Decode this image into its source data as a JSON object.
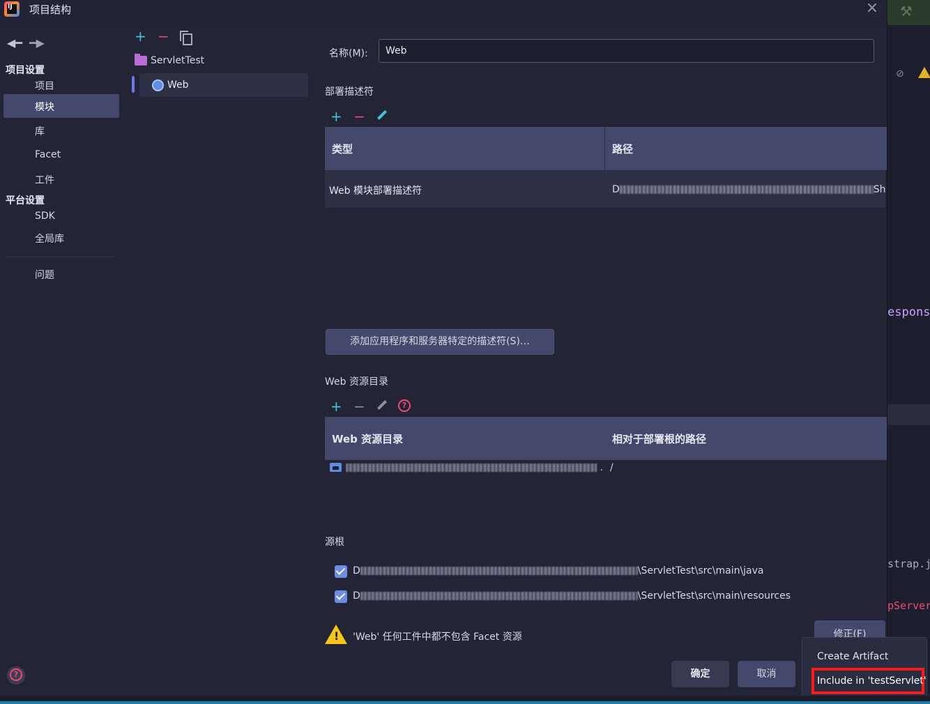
{
  "window": {
    "title": "项目结构",
    "close": "×"
  },
  "nav": {
    "back_icon": "arrow-left-icon",
    "forward_icon": "arrow-right-icon",
    "sections": [
      {
        "title": "项目设置",
        "items": [
          "项目",
          "模块",
          "库",
          "Facet",
          "工件"
        ]
      },
      {
        "title": "平台设置",
        "items": [
          "SDK",
          "全局库"
        ]
      }
    ],
    "problems": "问题",
    "selected": "模块"
  },
  "tree": {
    "add": "+",
    "remove": "−",
    "root": "ServletTest",
    "child": "Web"
  },
  "name": {
    "label": "名称(M):",
    "value": "Web"
  },
  "descriptors": {
    "title": "部署描述符",
    "columns": [
      "类型",
      "路径"
    ],
    "rows": [
      {
        "type": "Web 模块部署描述符",
        "path_prefix": "D",
        "path_suffix": "Sh"
      }
    ],
    "add_button": "添加应用程序和服务器特定的描述符(S)…"
  },
  "web_resources": {
    "title": "Web 资源目录",
    "columns": [
      "Web 资源目录",
      "相对于部署根的路径"
    ],
    "rows": [
      {
        "path_prefix": "",
        "path_suffix": "..",
        "relative": "/"
      }
    ]
  },
  "source_roots": {
    "title": "源根",
    "items": [
      {
        "prefix": "D",
        "suffix": "\\ServletTest\\src\\main\\java",
        "checked": true
      },
      {
        "prefix": "D",
        "suffix": "\\ServletTest\\src\\main\\resources",
        "checked": true
      }
    ]
  },
  "warning": {
    "text": "'Web' 任何工件中都不包含 Facet 资源",
    "mark": "!"
  },
  "buttons": {
    "fix": "修正(F)",
    "ok": "确定",
    "cancel": "取消"
  },
  "popup": {
    "items": [
      "Create Artifact",
      "Include in 'testServlet'"
    ]
  },
  "background_editor": {
    "code_1": "espons",
    "code_2": "strap.j",
    "code_3": "pServer"
  },
  "colors": {
    "accent": "#3ec5dc",
    "danger": "#f04a74",
    "selection": "#44486a",
    "highlight_box": "#ff1a1a",
    "warning": "#f5c518"
  }
}
